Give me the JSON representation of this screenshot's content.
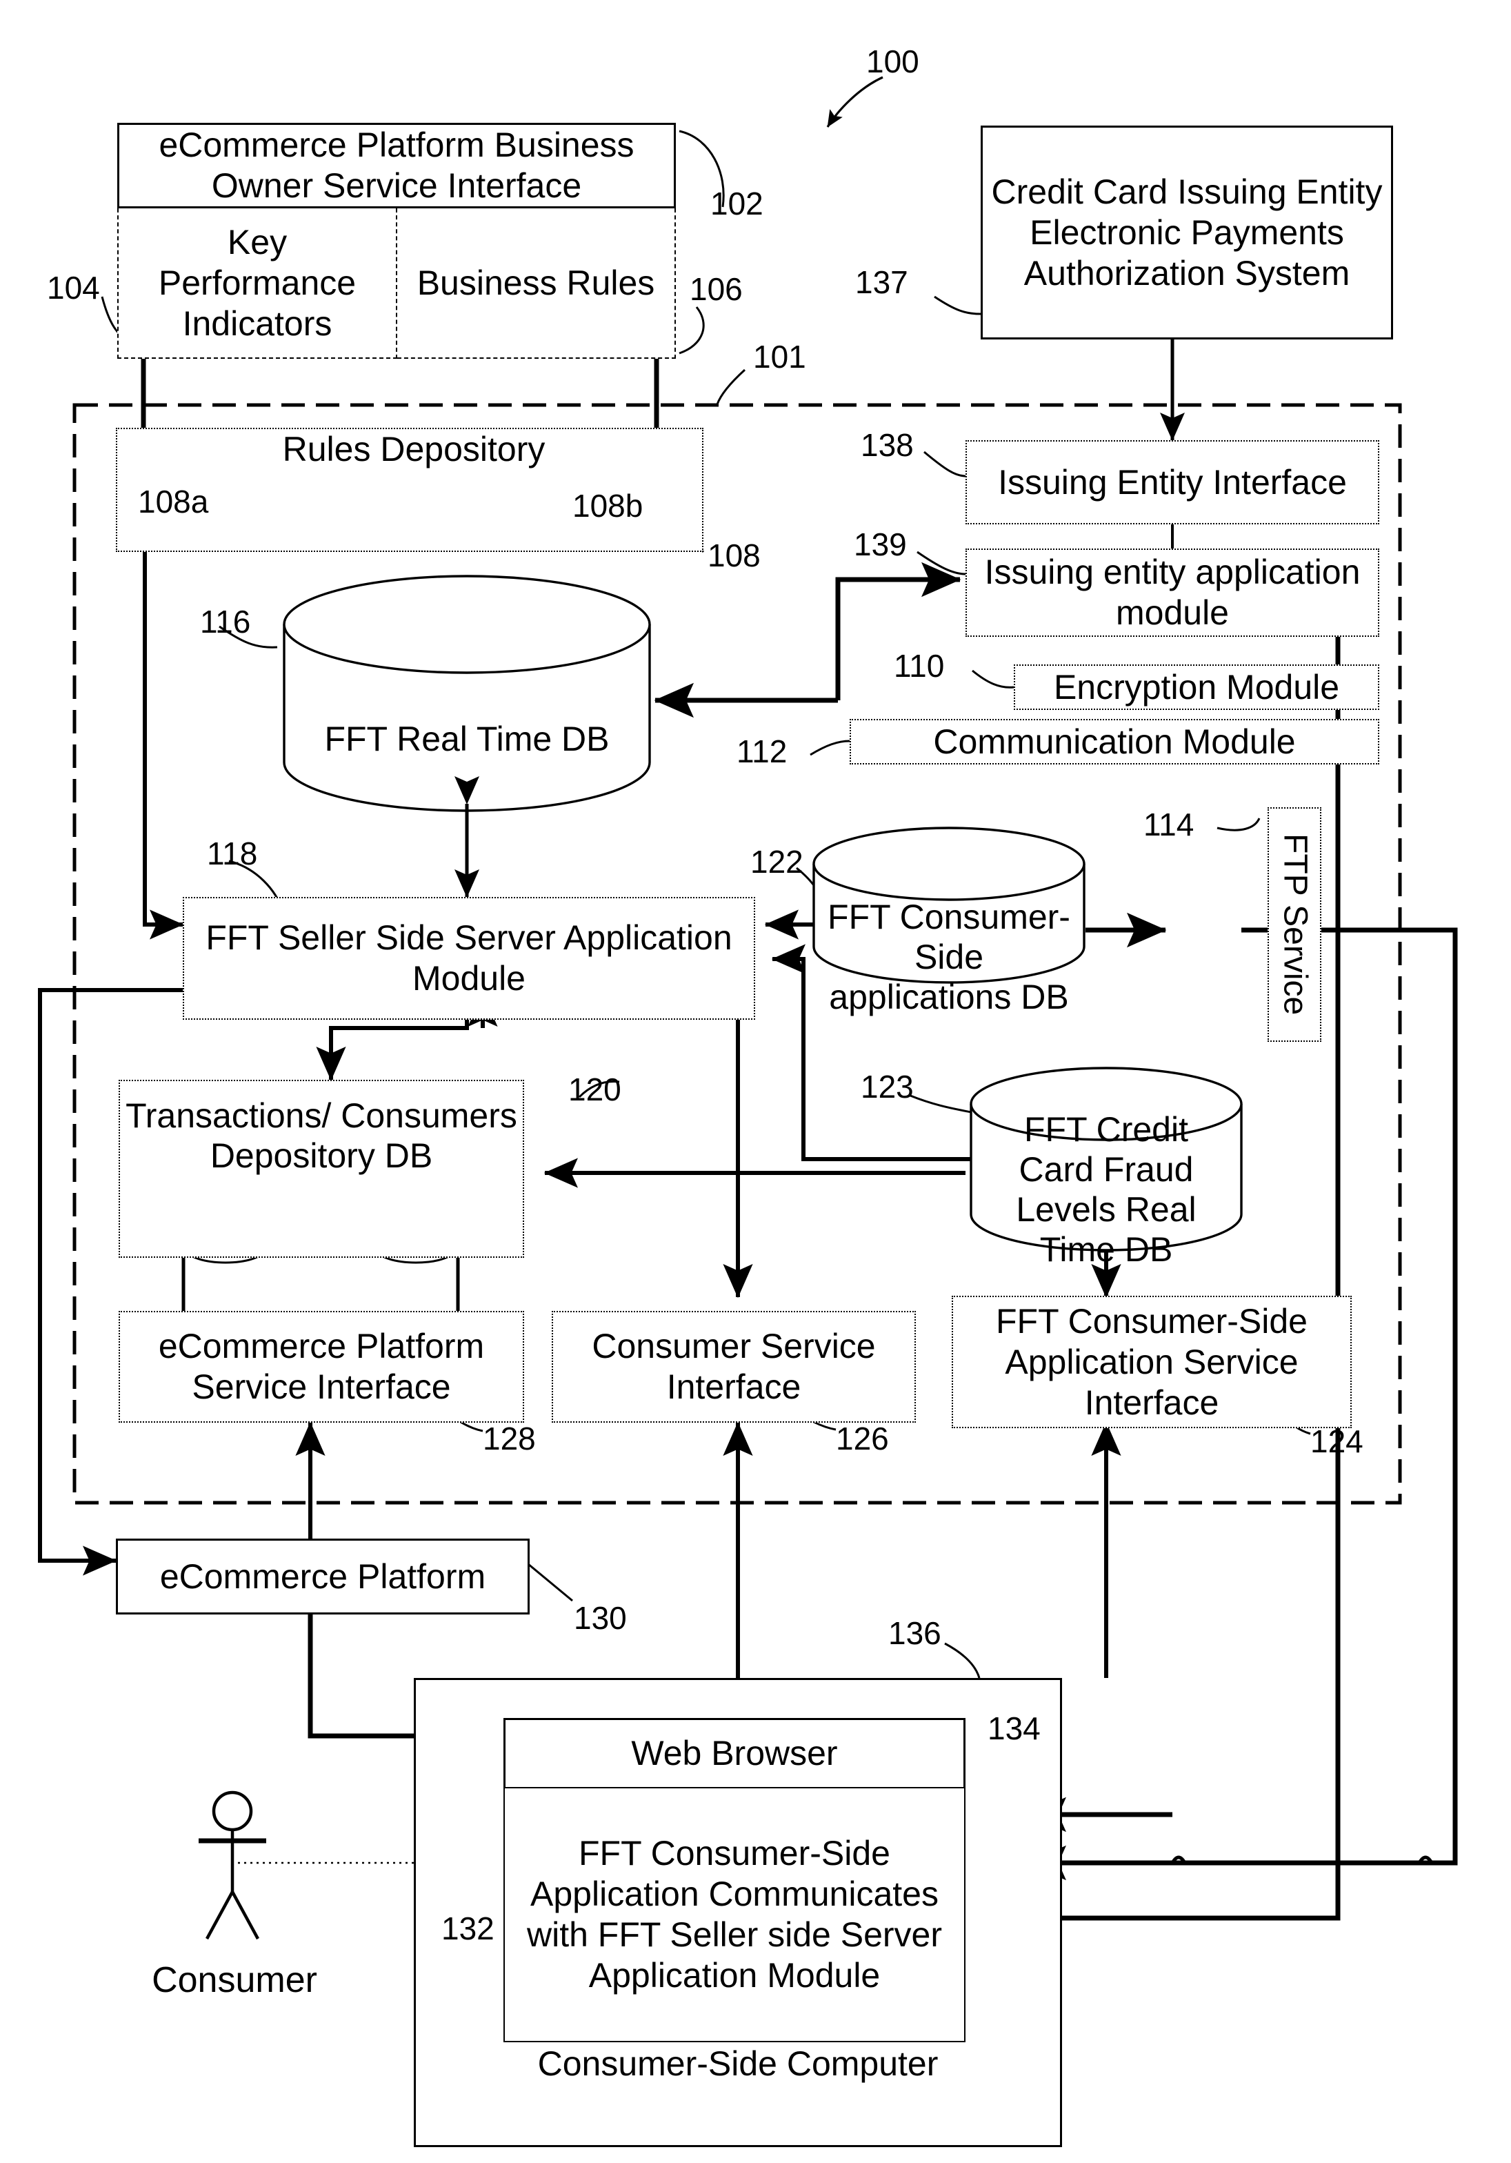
{
  "figure": {
    "system_ref": "100",
    "boundary_ref": "101"
  },
  "blocks": {
    "owner_service_interface": {
      "label": "eCommerce Platform Business Owner Service Interface",
      "ref": "102"
    },
    "key_performance_indicators": {
      "label": "Key Performance Indicators",
      "ref": "104"
    },
    "business_rules": {
      "label": "Business Rules",
      "ref": "106"
    },
    "credit_card_issuing": {
      "label": "Credit Card Issuing Entity Electronic Payments Authorization System",
      "ref": "137"
    },
    "rules_depository": {
      "label": "Rules Depository",
      "ref": "108",
      "db_left_ref": "108a",
      "db_right_ref": "108b"
    },
    "issuing_entity_interface": {
      "label": "Issuing Entity Interface",
      "ref": "138"
    },
    "issuing_entity_application_module": {
      "label": "Issuing entity application module",
      "ref": "139"
    },
    "encryption_module": {
      "label": "Encryption Module",
      "ref": "110"
    },
    "communication_module": {
      "label": "Communication Module",
      "ref": "112"
    },
    "fft_real_time_db": {
      "label": "FFT Real Time DB",
      "ref": "116"
    },
    "ftp_service": {
      "label": "FTP Service",
      "ref": "114"
    },
    "fft_seller_side_server": {
      "label": "FFT Seller Side Server Application Module",
      "ref": "118"
    },
    "fft_consumer_side_applications_db": {
      "label": "FFT Consumer-Side applications DB",
      "ref": "122"
    },
    "fft_credit_card_fraud_levels_db": {
      "label": "FFT Credit Card Fraud Levels Real Time DB",
      "ref": "123"
    },
    "transactions_consumers_depository_db": {
      "label": "Transactions/ Consumers Depository DB",
      "ref": "120"
    },
    "ecommerce_platform_service_interface": {
      "label": "eCommerce Platform Service Interface",
      "ref": "128"
    },
    "consumer_service_interface": {
      "label": "Consumer Service Interface",
      "ref": "126"
    },
    "fft_consumer_side_application_service_interface": {
      "label": "FFT Consumer-Side Application Service Interface",
      "ref": "124"
    },
    "ecommerce_platform": {
      "label": "eCommerce Platform",
      "ref": "130"
    },
    "web_browser": {
      "label": "Web Browser",
      "ref": "134"
    },
    "fft_consumer_side_application": {
      "label": "FFT Consumer-Side Application Communicates with  FFT Seller side Server Application Module",
      "ref": "132"
    },
    "consumer_side_computer": {
      "label": "Consumer-Side Computer",
      "ref": "136"
    },
    "consumer_actor": {
      "label": "Consumer",
      "icon": "stick-figure-icon"
    }
  },
  "colors": {
    "stroke": "#000000",
    "background": "#ffffff"
  }
}
